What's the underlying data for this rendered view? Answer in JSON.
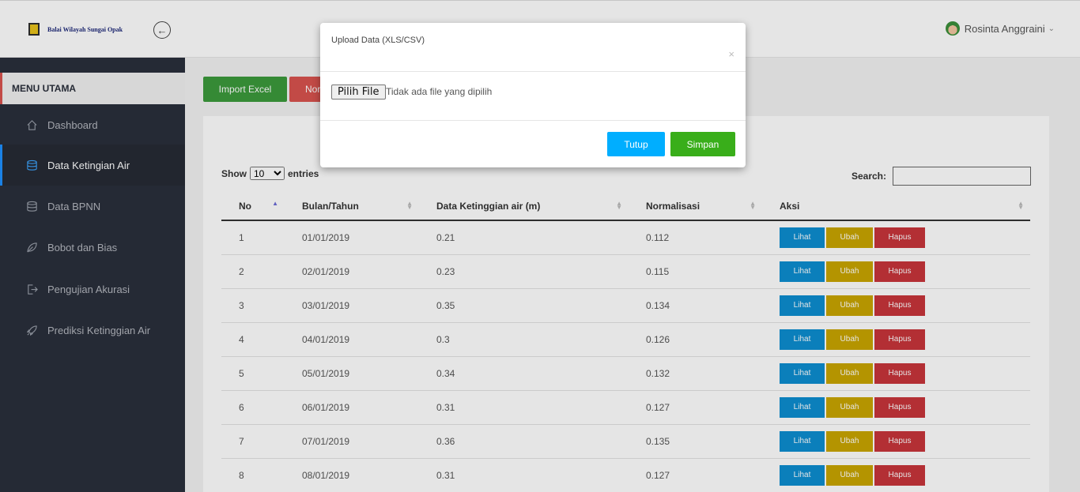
{
  "header": {
    "logo_text": "Balai Wilayah Sungai Opak",
    "user_name": "Rosinta Anggraini"
  },
  "sidebar": {
    "title": "MENU UTAMA",
    "items": [
      {
        "label": "Dashboard",
        "icon": "home-icon",
        "active": false
      },
      {
        "label": "Data Ketingian Air",
        "icon": "database-icon",
        "active": true
      },
      {
        "label": "Data BPNN",
        "icon": "database-icon",
        "active": false
      },
      {
        "label": "Bobot dan Bias",
        "icon": "leaf-icon",
        "active": false
      },
      {
        "label": "Pengujian Akurasi",
        "icon": "logout-icon",
        "active": false
      },
      {
        "label": "Prediksi Ketinggian Air",
        "icon": "rocket-icon",
        "active": false
      }
    ]
  },
  "toolbar": {
    "import_label": "Import Excel",
    "norm_label": "Normalisasi"
  },
  "datatable": {
    "show_label": "Show",
    "entries_value": "10",
    "entries_label": "entries",
    "search_label": "Search:",
    "search_value": "",
    "columns": [
      "No",
      "Bulan/Tahun",
      "Data Ketinggian air (m)",
      "Normalisasi",
      "Aksi"
    ],
    "rows": [
      [
        "1",
        "01/01/2019",
        "0.21",
        "0.112"
      ],
      [
        "2",
        "02/01/2019",
        "0.23",
        "0.115"
      ],
      [
        "3",
        "03/01/2019",
        "0.35",
        "0.134"
      ],
      [
        "4",
        "04/01/2019",
        "0.3",
        "0.126"
      ],
      [
        "5",
        "05/01/2019",
        "0.34",
        "0.132"
      ],
      [
        "6",
        "06/01/2019",
        "0.31",
        "0.127"
      ],
      [
        "7",
        "07/01/2019",
        "0.36",
        "0.135"
      ],
      [
        "8",
        "08/01/2019",
        "0.31",
        "0.127"
      ]
    ],
    "actions": {
      "view": "Lihat",
      "edit": "Ubah",
      "delete": "Hapus"
    }
  },
  "modal": {
    "title": "Upload Data (XLS/CSV)",
    "close_symbol": "×",
    "file_button": "Pilih File",
    "file_status": "Tidak ada file yang dipilih",
    "close_label": "Tutup",
    "save_label": "Simpan"
  },
  "colors": {
    "sidebar_bg": "#2a2f3b",
    "accent_blue": "#00aeff",
    "accent_green": "#39ae1a",
    "view": "#0d8ed1",
    "edit": "#c9a500",
    "delete": "#c8353a"
  }
}
